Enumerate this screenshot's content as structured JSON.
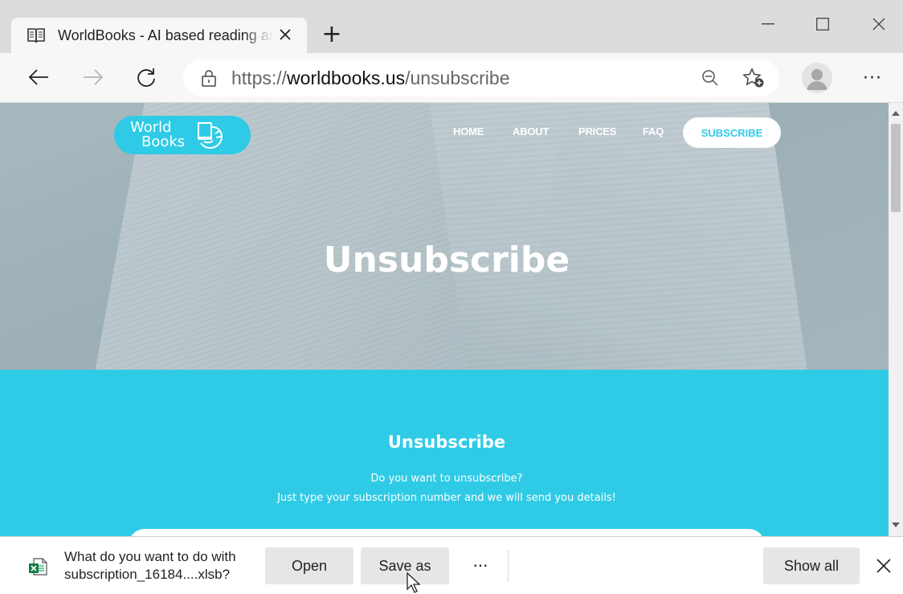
{
  "browser": {
    "tab_title": "WorldBooks - AI based reading and",
    "tab_icon": "book-icon",
    "new_tab_label": "+",
    "url_prefix": "https://",
    "url_domain": "worldbooks.us",
    "url_path": "/unsubscribe"
  },
  "site": {
    "logo_line1": "World",
    "logo_line2": "Books",
    "nav": {
      "home": "HOME",
      "about": "ABOUT",
      "prices": "PRICES",
      "faq": "FAQ",
      "subscribe": "SUBSCRIBE"
    },
    "hero_title": "Unsubscribe",
    "section_title": "Unsubscribe",
    "section_line1": "Do you want to unsubscribe?",
    "section_line2": "Just type your subscription number and we will send you details!",
    "brand_color": "#2fcbe6"
  },
  "download": {
    "line1": "What do you want to do with",
    "line2": "subscription_16184....xlsb?",
    "open_label": "Open",
    "save_as_label": "Save as",
    "more_label": "···",
    "show_all_label": "Show all",
    "file_icon": "excel-file-icon"
  }
}
